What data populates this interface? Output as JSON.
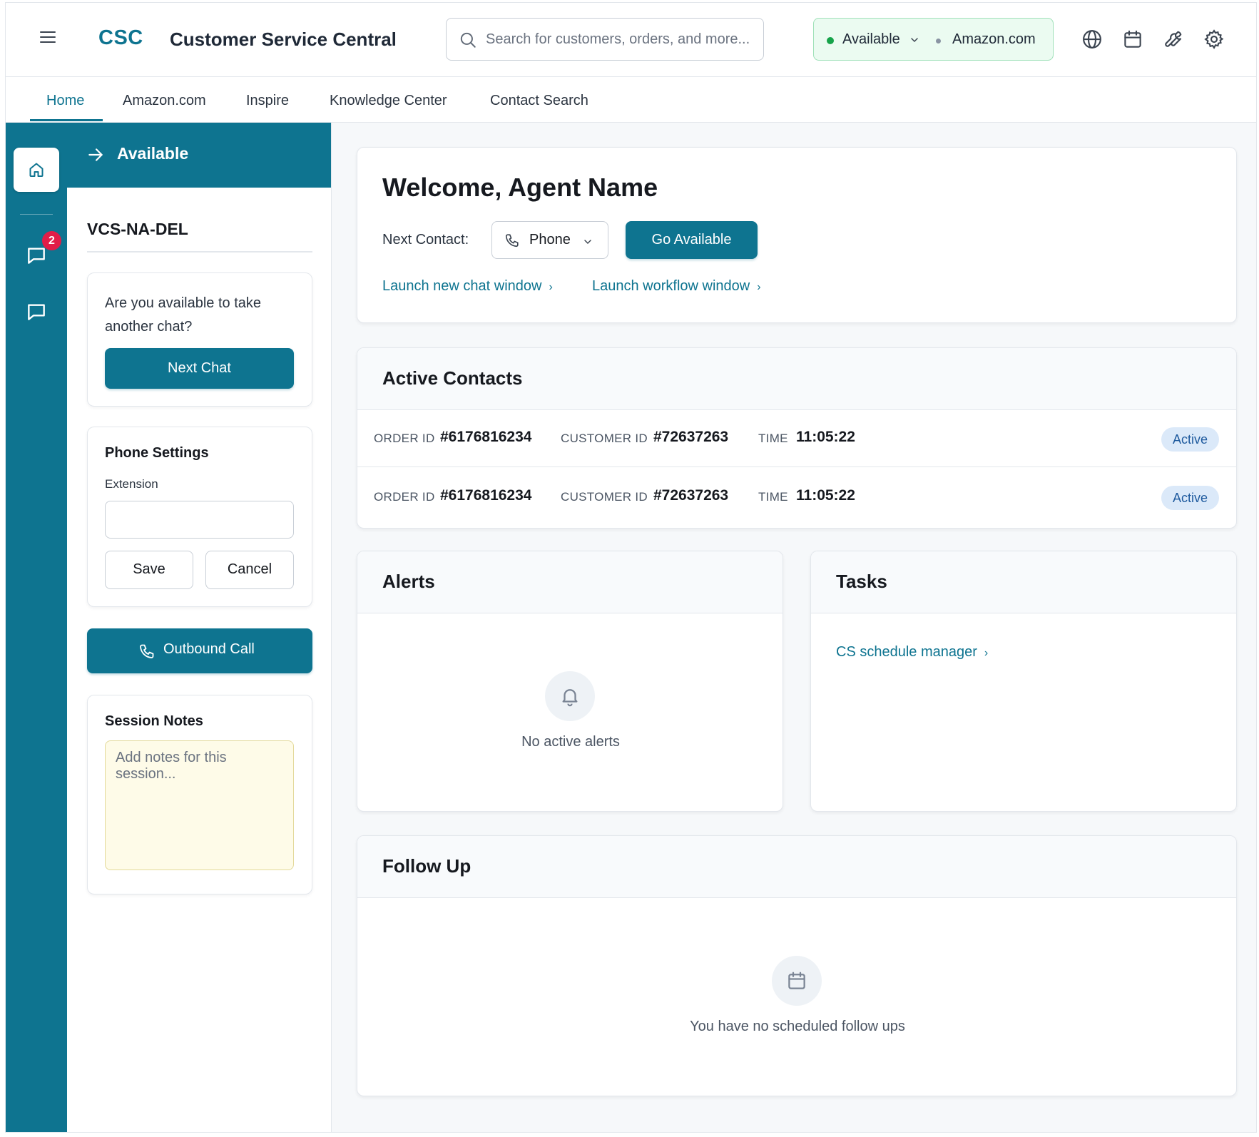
{
  "header": {
    "logo": "CSC",
    "title": "Customer Service Central",
    "search_placeholder": "Search for customers, orders, and more...",
    "status": {
      "label": "Available",
      "color": "#16a34a"
    },
    "marketplace": "Amazon.com",
    "icons": [
      "globe-icon",
      "calendar-icon",
      "wrench-icon",
      "gear-icon"
    ]
  },
  "nav": {
    "tabs": [
      {
        "label": "Home",
        "active": true
      },
      {
        "label": "Amazon.com",
        "active": false
      },
      {
        "label": "Inspire",
        "active": false
      },
      {
        "label": "Knowledge Center",
        "active": false
      },
      {
        "label": "Contact Search",
        "active": false
      }
    ]
  },
  "rail": {
    "icons": [
      "home-icon",
      "chat-icon",
      "chat-icon"
    ],
    "chat_badge": "2"
  },
  "side": {
    "banner_label": "Available",
    "queue": "VCS-NA-DEL",
    "availability_prompt": "Are you available to take another chat?",
    "next_chat_label": "Next Chat",
    "phone_settings": {
      "title": "Phone Settings",
      "extension_label": "Extension",
      "extension_value": "",
      "save_label": "Save",
      "cancel_label": "Cancel"
    },
    "outbound_call_label": "Outbound Call",
    "session_notes": {
      "title": "Session Notes",
      "placeholder": "Add notes for this session..."
    }
  },
  "welcome": {
    "title": "Welcome, Agent Name",
    "next_contact_label": "Next Contact:",
    "next_contact_value": "Phone",
    "go_available_label": "Go Available",
    "links": [
      "Launch new chat window",
      "Launch workflow window"
    ]
  },
  "active_contacts": {
    "title": "Active Contacts",
    "labels": {
      "order": "ORDER ID",
      "customer": "CUSTOMER ID",
      "time": "TIME"
    },
    "rows": [
      {
        "order_id": "#6176816234",
        "customer_id": "#72637263",
        "time": "11:05:22",
        "status": "Active"
      },
      {
        "order_id": "#6176816234",
        "customer_id": "#72637263",
        "time": "11:05:22",
        "status": "Active"
      }
    ]
  },
  "alerts": {
    "title": "Alerts",
    "empty_text": "No active alerts"
  },
  "tasks": {
    "title": "Tasks",
    "links": [
      "CS schedule manager"
    ]
  },
  "follow_up": {
    "title": "Follow Up",
    "empty_text": "You have no scheduled follow ups"
  },
  "colors": {
    "accent": "#0e7490",
    "status_green": "#16a34a",
    "badge_red": "#e11d48",
    "notes_bg": "#fefbe8"
  }
}
